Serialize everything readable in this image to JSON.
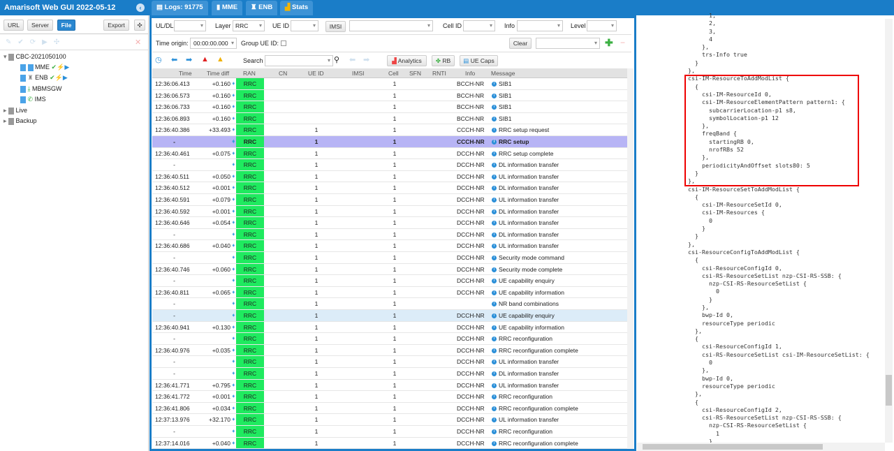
{
  "app": {
    "title": "Amarisoft Web GUI 2022-05-12"
  },
  "tabs": [
    {
      "label": "Logs: 91775",
      "icon": "document-icon"
    },
    {
      "label": "MME",
      "icon": "server-icon"
    },
    {
      "label": "ENB",
      "icon": "antenna-icon"
    },
    {
      "label": "Stats",
      "icon": "chart-icon"
    }
  ],
  "left": {
    "buttons": {
      "url": "URL",
      "server": "Server",
      "file": "File",
      "export": "Export"
    },
    "tree": {
      "root": "CBC-2021050100",
      "children": [
        "MME",
        "ENB",
        "MBMSGW",
        "IMS"
      ],
      "others": [
        "Live",
        "Backup"
      ]
    }
  },
  "filters": {
    "uldl_label": "UL/DL",
    "uldl_value": "",
    "layer_label": "Layer",
    "layer_value": "RRC",
    "ueid_label": "UE ID",
    "ueid_value": "",
    "imsi_label": "IMSI",
    "imsi_value": "",
    "cellid_label": "Cell ID",
    "info_label": "Info",
    "level_label": "Level",
    "time_origin_label": "Time origin:",
    "time_origin_value": "00:00:00.000",
    "group_label": "Group UE ID:",
    "clear": "Clear",
    "search_label": "Search",
    "analytics": "Analytics",
    "rb": "RB",
    "uecaps": "UE Caps"
  },
  "table": {
    "headers": [
      "Time",
      "Time diff",
      "RAN",
      "CN",
      "UE ID",
      "IMSI",
      "Cell",
      "SFN",
      "RNTI",
      "Info",
      "Message"
    ],
    "rows": [
      [
        "12:36:06.413",
        "+0.160",
        "RRC",
        "",
        "",
        "",
        "1",
        "",
        "",
        "BCCH-NR",
        "SIB1"
      ],
      [
        "12:36:06.573",
        "+0.160",
        "RRC",
        "",
        "",
        "",
        "1",
        "",
        "",
        "BCCH-NR",
        "SIB1"
      ],
      [
        "12:36:06.733",
        "+0.160",
        "RRC",
        "",
        "",
        "",
        "1",
        "",
        "",
        "BCCH-NR",
        "SIB1"
      ],
      [
        "12:36:06.893",
        "+0.160",
        "RRC",
        "",
        "",
        "",
        "1",
        "",
        "",
        "BCCH-NR",
        "SIB1"
      ],
      [
        "12:36:40.386",
        "+33.493",
        "RRC",
        "",
        "1",
        "",
        "1",
        "",
        "",
        "CCCH-NR",
        "RRC setup request"
      ],
      [
        "-",
        "",
        "RRC",
        "",
        "1",
        "",
        "1",
        "",
        "",
        "CCCH-NR",
        "RRC setup"
      ],
      [
        "12:36:40.461",
        "+0.075",
        "RRC",
        "",
        "1",
        "",
        "1",
        "",
        "",
        "DCCH-NR",
        "RRC setup complete"
      ],
      [
        "-",
        "",
        "RRC",
        "",
        "1",
        "",
        "1",
        "",
        "",
        "DCCH-NR",
        "DL information transfer"
      ],
      [
        "12:36:40.511",
        "+0.050",
        "RRC",
        "",
        "1",
        "",
        "1",
        "",
        "",
        "DCCH-NR",
        "UL information transfer"
      ],
      [
        "12:36:40.512",
        "+0.001",
        "RRC",
        "",
        "1",
        "",
        "1",
        "",
        "",
        "DCCH-NR",
        "DL information transfer"
      ],
      [
        "12:36:40.591",
        "+0.079",
        "RRC",
        "",
        "1",
        "",
        "1",
        "",
        "",
        "DCCH-NR",
        "UL information transfer"
      ],
      [
        "12:36:40.592",
        "+0.001",
        "RRC",
        "",
        "1",
        "",
        "1",
        "",
        "",
        "DCCH-NR",
        "DL information transfer"
      ],
      [
        "12:36:40.646",
        "+0.054",
        "RRC",
        "",
        "1",
        "",
        "1",
        "",
        "",
        "DCCH-NR",
        "UL information transfer"
      ],
      [
        "-",
        "",
        "RRC",
        "",
        "1",
        "",
        "1",
        "",
        "",
        "DCCH-NR",
        "DL information transfer"
      ],
      [
        "12:36:40.686",
        "+0.040",
        "RRC",
        "",
        "1",
        "",
        "1",
        "",
        "",
        "DCCH-NR",
        "UL information transfer"
      ],
      [
        "-",
        "",
        "RRC",
        "",
        "1",
        "",
        "1",
        "",
        "",
        "DCCH-NR",
        "Security mode command"
      ],
      [
        "12:36:40.746",
        "+0.060",
        "RRC",
        "",
        "1",
        "",
        "1",
        "",
        "",
        "DCCH-NR",
        "Security mode complete"
      ],
      [
        "-",
        "",
        "RRC",
        "",
        "1",
        "",
        "1",
        "",
        "",
        "DCCH-NR",
        "UE capability enquiry"
      ],
      [
        "12:36:40.811",
        "+0.065",
        "RRC",
        "",
        "1",
        "",
        "1",
        "",
        "",
        "DCCH-NR",
        "UE capability information"
      ],
      [
        "-",
        "",
        "RRC",
        "",
        "1",
        "",
        "1",
        "",
        "",
        "",
        "NR band combinations"
      ],
      [
        "-",
        "",
        "RRC",
        "",
        "1",
        "",
        "1",
        "",
        "",
        "DCCH-NR",
        "UE capability enquiry"
      ],
      [
        "12:36:40.941",
        "+0.130",
        "RRC",
        "",
        "1",
        "",
        "1",
        "",
        "",
        "DCCH-NR",
        "UE capability information"
      ],
      [
        "-",
        "",
        "RRC",
        "",
        "1",
        "",
        "1",
        "",
        "",
        "DCCH-NR",
        "RRC reconfiguration"
      ],
      [
        "12:36:40.976",
        "+0.035",
        "RRC",
        "",
        "1",
        "",
        "1",
        "",
        "",
        "DCCH-NR",
        "RRC reconfiguration complete"
      ],
      [
        "-",
        "",
        "RRC",
        "",
        "1",
        "",
        "1",
        "",
        "",
        "DCCH-NR",
        "UL information transfer"
      ],
      [
        "-",
        "",
        "RRC",
        "",
        "1",
        "",
        "1",
        "",
        "",
        "DCCH-NR",
        "DL information transfer"
      ],
      [
        "12:36:41.771",
        "+0.795",
        "RRC",
        "",
        "1",
        "",
        "1",
        "",
        "",
        "DCCH-NR",
        "UL information transfer"
      ],
      [
        "12:36:41.772",
        "+0.001",
        "RRC",
        "",
        "1",
        "",
        "1",
        "",
        "",
        "DCCH-NR",
        "RRC reconfiguration"
      ],
      [
        "12:36:41.806",
        "+0.034",
        "RRC",
        "",
        "1",
        "",
        "1",
        "",
        "",
        "DCCH-NR",
        "RRC reconfiguration complete"
      ],
      [
        "12:37:13.976",
        "+32.170",
        "RRC",
        "",
        "1",
        "",
        "1",
        "",
        "",
        "DCCH-NR",
        "UL information transfer"
      ],
      [
        "-",
        "",
        "RRC",
        "",
        "1",
        "",
        "1",
        "",
        "",
        "DCCH-NR",
        "RRC reconfiguration"
      ],
      [
        "12:37:14.016",
        "+0.040",
        "RRC",
        "",
        "1",
        "",
        "1",
        "",
        "",
        "DCCH-NR",
        "RRC reconfiguration complete"
      ]
    ],
    "selected_row": 5,
    "highlighted_row": 20
  },
  "colors": {
    "accent": "#1a7dc8",
    "ran": "#1fea5f",
    "selected": "#b7b4f5",
    "highlight_box": "#e00000"
  },
  "detail": {
    "lines": [
      "      1,",
      "      2,",
      "      3,",
      "      4",
      "    },",
      "    trs-Info true",
      "  }",
      "},",
      "csi-IM-ResourceToAddModList {",
      "  {",
      "    csi-IM-ResourceId 0,",
      "    csi-IM-ResourceElementPattern pattern1: {",
      "      subcarrierLocation-p1 s8,",
      "      symbolLocation-p1 12",
      "    },",
      "    freqBand {",
      "      startingRB 0,",
      "      nrofRBs 52",
      "    },",
      "    periodicityAndOffset slots80: 5",
      "  }",
      "},",
      "csi-IM-ResourceSetToAddModList {",
      "  {",
      "    csi-IM-ResourceSetId 0,",
      "    csi-IM-Resources {",
      "      0",
      "    }",
      "  }",
      "},",
      "csi-ResourceConfigToAddModList {",
      "  {",
      "    csi-ResourceConfigId 0,",
      "    csi-RS-ResourceSetList nzp-CSI-RS-SSB: {",
      "      nzp-CSI-RS-ResourceSetList {",
      "        0",
      "      }",
      "    },",
      "    bwp-Id 0,",
      "    resourceType periodic",
      "  },",
      "  {",
      "    csi-ResourceConfigId 1,",
      "    csi-RS-ResourceSetList csi-IM-ResourceSetList: {",
      "      0",
      "    },",
      "    bwp-Id 0,",
      "    resourceType periodic",
      "  },",
      "  {",
      "    csi-ResourceConfigId 2,",
      "    csi-RS-ResourceSetList nzp-CSI-RS-SSB: {",
      "      nzp-CSI-RS-ResourceSetList {",
      "        1",
      "      }"
    ]
  }
}
